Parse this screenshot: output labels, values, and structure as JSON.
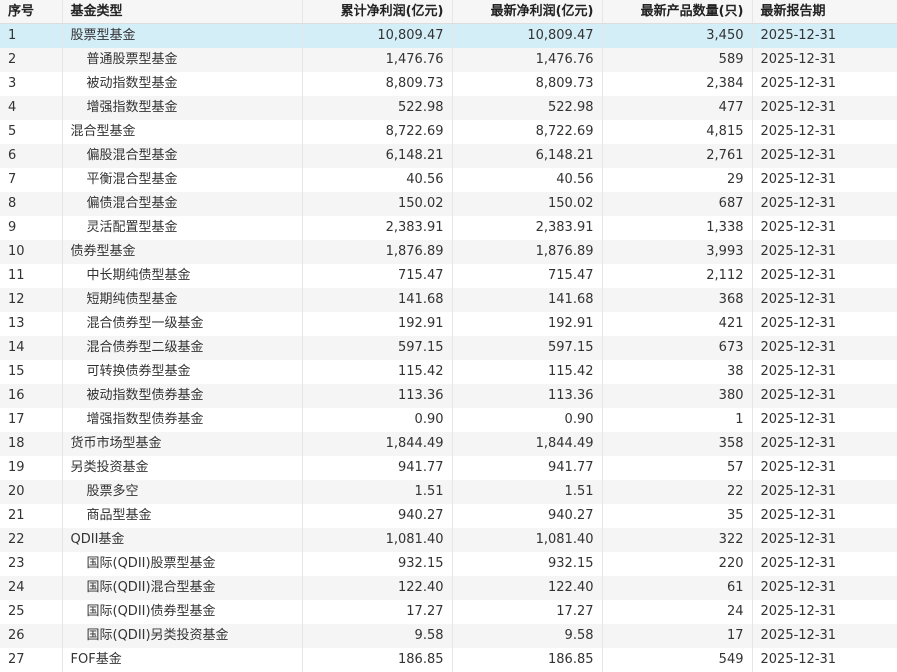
{
  "table": {
    "headers": {
      "index": "序号",
      "type": "基金类型",
      "cumulative": "累计净利润(亿元)",
      "latest": "最新净利润(亿元)",
      "count": "最新产品数量(只)",
      "date": "最新报告期"
    },
    "rows": [
      {
        "index": "1",
        "type": "股票型基金",
        "cumulative": "10,809.47",
        "latest": "10,809.47",
        "count": "3,450",
        "date": "2025-12-31",
        "sub": false,
        "selected": true
      },
      {
        "index": "2",
        "type": "普通股票型基金",
        "cumulative": "1,476.76",
        "latest": "1,476.76",
        "count": "589",
        "date": "2025-12-31",
        "sub": true
      },
      {
        "index": "3",
        "type": "被动指数型基金",
        "cumulative": "8,809.73",
        "latest": "8,809.73",
        "count": "2,384",
        "date": "2025-12-31",
        "sub": true
      },
      {
        "index": "4",
        "type": "增强指数型基金",
        "cumulative": "522.98",
        "latest": "522.98",
        "count": "477",
        "date": "2025-12-31",
        "sub": true
      },
      {
        "index": "5",
        "type": "混合型基金",
        "cumulative": "8,722.69",
        "latest": "8,722.69",
        "count": "4,815",
        "date": "2025-12-31",
        "sub": false
      },
      {
        "index": "6",
        "type": "偏股混合型基金",
        "cumulative": "6,148.21",
        "latest": "6,148.21",
        "count": "2,761",
        "date": "2025-12-31",
        "sub": true
      },
      {
        "index": "7",
        "type": "平衡混合型基金",
        "cumulative": "40.56",
        "latest": "40.56",
        "count": "29",
        "date": "2025-12-31",
        "sub": true
      },
      {
        "index": "8",
        "type": "偏债混合型基金",
        "cumulative": "150.02",
        "latest": "150.02",
        "count": "687",
        "date": "2025-12-31",
        "sub": true
      },
      {
        "index": "9",
        "type": "灵活配置型基金",
        "cumulative": "2,383.91",
        "latest": "2,383.91",
        "count": "1,338",
        "date": "2025-12-31",
        "sub": true
      },
      {
        "index": "10",
        "type": "债券型基金",
        "cumulative": "1,876.89",
        "latest": "1,876.89",
        "count": "3,993",
        "date": "2025-12-31",
        "sub": false
      },
      {
        "index": "11",
        "type": "中长期纯债型基金",
        "cumulative": "715.47",
        "latest": "715.47",
        "count": "2,112",
        "date": "2025-12-31",
        "sub": true
      },
      {
        "index": "12",
        "type": "短期纯债型基金",
        "cumulative": "141.68",
        "latest": "141.68",
        "count": "368",
        "date": "2025-12-31",
        "sub": true
      },
      {
        "index": "13",
        "type": "混合债券型一级基金",
        "cumulative": "192.91",
        "latest": "192.91",
        "count": "421",
        "date": "2025-12-31",
        "sub": true
      },
      {
        "index": "14",
        "type": "混合债券型二级基金",
        "cumulative": "597.15",
        "latest": "597.15",
        "count": "673",
        "date": "2025-12-31",
        "sub": true
      },
      {
        "index": "15",
        "type": "可转换债券型基金",
        "cumulative": "115.42",
        "latest": "115.42",
        "count": "38",
        "date": "2025-12-31",
        "sub": true
      },
      {
        "index": "16",
        "type": "被动指数型债券基金",
        "cumulative": "113.36",
        "latest": "113.36",
        "count": "380",
        "date": "2025-12-31",
        "sub": true
      },
      {
        "index": "17",
        "type": "增强指数型债券基金",
        "cumulative": "0.90",
        "latest": "0.90",
        "count": "1",
        "date": "2025-12-31",
        "sub": true
      },
      {
        "index": "18",
        "type": "货币市场型基金",
        "cumulative": "1,844.49",
        "latest": "1,844.49",
        "count": "358",
        "date": "2025-12-31",
        "sub": false
      },
      {
        "index": "19",
        "type": "另类投资基金",
        "cumulative": "941.77",
        "latest": "941.77",
        "count": "57",
        "date": "2025-12-31",
        "sub": false
      },
      {
        "index": "20",
        "type": "股票多空",
        "cumulative": "1.51",
        "latest": "1.51",
        "count": "22",
        "date": "2025-12-31",
        "sub": true
      },
      {
        "index": "21",
        "type": "商品型基金",
        "cumulative": "940.27",
        "latest": "940.27",
        "count": "35",
        "date": "2025-12-31",
        "sub": true
      },
      {
        "index": "22",
        "type": "QDII基金",
        "cumulative": "1,081.40",
        "latest": "1,081.40",
        "count": "322",
        "date": "2025-12-31",
        "sub": false
      },
      {
        "index": "23",
        "type": "国际(QDII)股票型基金",
        "cumulative": "932.15",
        "latest": "932.15",
        "count": "220",
        "date": "2025-12-31",
        "sub": true
      },
      {
        "index": "24",
        "type": "国际(QDII)混合型基金",
        "cumulative": "122.40",
        "latest": "122.40",
        "count": "61",
        "date": "2025-12-31",
        "sub": true
      },
      {
        "index": "25",
        "type": "国际(QDII)债券型基金",
        "cumulative": "17.27",
        "latest": "17.27",
        "count": "24",
        "date": "2025-12-31",
        "sub": true
      },
      {
        "index": "26",
        "type": "国际(QDII)另类投资基金",
        "cumulative": "9.58",
        "latest": "9.58",
        "count": "17",
        "date": "2025-12-31",
        "sub": true
      },
      {
        "index": "27",
        "type": "FOF基金",
        "cumulative": "186.85",
        "latest": "186.85",
        "count": "549",
        "date": "2025-12-31",
        "sub": false
      }
    ]
  },
  "colors": {
    "selected_row": "#d4eef8",
    "striped_row": "#f5f5f5",
    "header_bg": "#f6f6f6"
  }
}
